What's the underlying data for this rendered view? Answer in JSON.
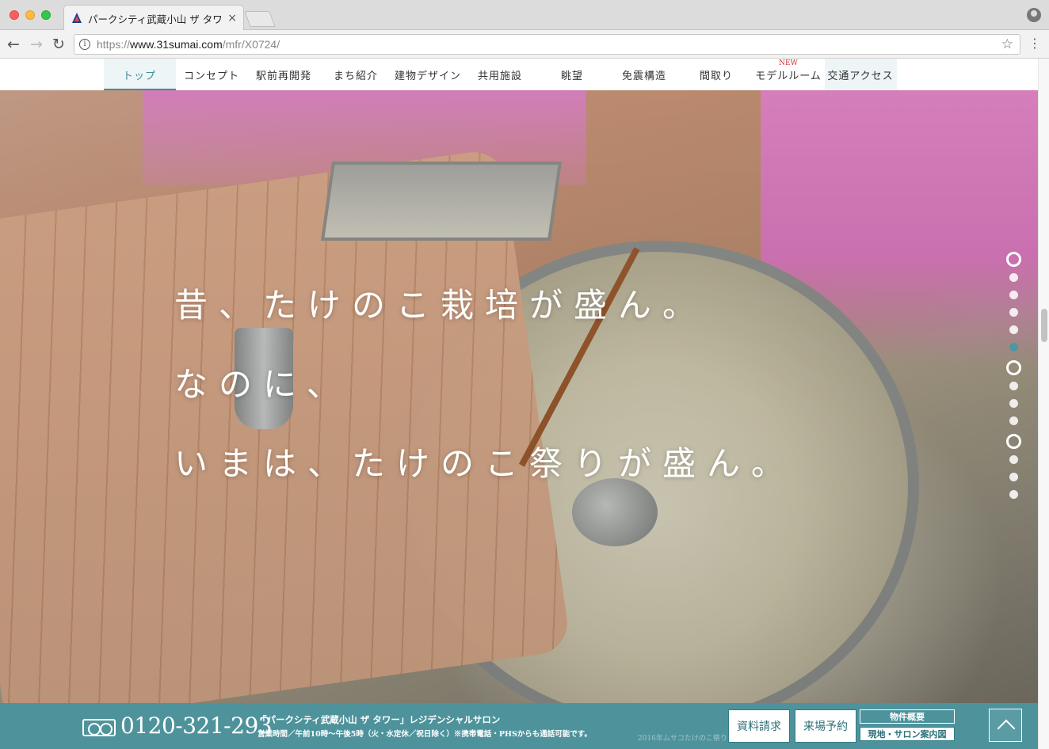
{
  "browser": {
    "tab_title": "パークシティ武蔵小山 ザ タワー",
    "tab_close": "×",
    "url_prefix": "https://",
    "url_domain": "www.31sumai.com",
    "url_path": "/mfr/X0724/",
    "info_glyph": "i",
    "back_glyph": "←",
    "forward_glyph": "→",
    "reload_glyph": "↻",
    "star_glyph": "☆",
    "menu_glyph": "⋮"
  },
  "nav": {
    "items": [
      {
        "label": "トップ"
      },
      {
        "label": "コンセプト"
      },
      {
        "label": "駅前再開発"
      },
      {
        "label": "まち紹介"
      },
      {
        "label": "建物デザイン"
      },
      {
        "label": "共用施設"
      },
      {
        "label": "眺望"
      },
      {
        "label": "免震構造"
      },
      {
        "label": "間取り"
      },
      {
        "label": "モデルルーム"
      },
      {
        "label": "交通アクセス"
      }
    ],
    "new_badge": "NEW"
  },
  "hero": {
    "lines": [
      "昔、たけのこ栽培が盛ん。",
      "なのに、",
      "いまは、たけのこ祭りが盛ん。"
    ],
    "caption": "2016年ムサコたけのこ祭り",
    "dots_total": 15,
    "dots_active_index": 5
  },
  "footer": {
    "phone": "0120-321-293",
    "salon": "「パークシティ武蔵小山 ザ タワー」レジデンシャルサロン",
    "hours": "営業時間／午前10時〜午後5時（火・水定休／祝日除く）※携帯電話・PHSからも通話可能です。",
    "request_button": "資料請求",
    "visit_button": "来場予約",
    "overview_link": "物件概要",
    "map_link": "現地・サロン案内図"
  },
  "colors": {
    "accent": "#3f8d97",
    "footer_bg": "#3f8a94",
    "new_badge": "#d03030"
  },
  "icons": [
    "back-arrow-icon",
    "forward-arrow-icon",
    "reload-icon",
    "info-icon",
    "star-icon",
    "menu-dots-icon",
    "profile-icon",
    "free-dial-icon",
    "scroll-top-icon"
  ]
}
